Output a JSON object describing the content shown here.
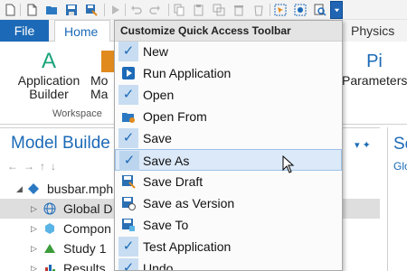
{
  "qat": {
    "icons": [
      "new-icon",
      "open-icon",
      "save-icon",
      "save-as-icon",
      "run-icon",
      "undo-icon",
      "redo-icon",
      "copy-icon",
      "paste-icon",
      "duplicate-icon",
      "delete-icon",
      "select-icon",
      "build-icon",
      "search-icon",
      "qat-dropdown-icon"
    ]
  },
  "tabs": {
    "file": "File",
    "home": "Home",
    "physics": "Physics"
  },
  "ribbon": {
    "app_builder_line1": "Application",
    "app_builder_line2": "Builder",
    "model_manager_line1": "Mo",
    "model_manager_line2": "Ma",
    "parameters_symbol": "Pi",
    "parameters_label": "Parameters",
    "group_workspace": "Workspace"
  },
  "model_builder": {
    "title": "Model Builde",
    "tree": [
      {
        "label": "busbar.mph",
        "icon": "model-icon",
        "indent": 0
      },
      {
        "label": "Global D",
        "icon": "globe-icon",
        "indent": 1,
        "selected": true
      },
      {
        "label": "Compon",
        "icon": "component-icon",
        "indent": 1
      },
      {
        "label": "Study 1",
        "icon": "study-icon",
        "indent": 1
      },
      {
        "label": "Results",
        "icon": "results-icon",
        "indent": 1
      }
    ]
  },
  "right_pane": {
    "title": "Se",
    "subtitle": "Glo"
  },
  "menu": {
    "header": "Customize Quick Access Toolbar",
    "items": [
      {
        "label": "New",
        "checked": true
      },
      {
        "label": "Run Application",
        "checked": false,
        "icon": "run-app-icon"
      },
      {
        "label": "Open",
        "checked": true
      },
      {
        "label": "Open From",
        "checked": false,
        "icon": "open-from-icon"
      },
      {
        "label": "Save",
        "checked": true
      },
      {
        "label": "Save As",
        "checked": true,
        "hover": true
      },
      {
        "label": "Save Draft",
        "checked": false,
        "icon": "save-draft-icon"
      },
      {
        "label": "Save as Version",
        "checked": false,
        "icon": "save-version-icon"
      },
      {
        "label": "Save To",
        "checked": false,
        "icon": "save-to-icon"
      },
      {
        "label": "Test Application",
        "checked": true
      },
      {
        "label": "Undo",
        "checked": true
      }
    ]
  },
  "colors": {
    "accent": "#1c6ab7",
    "menu_hover": "#dbe9f8",
    "check_bg": "#c8ddf2"
  }
}
